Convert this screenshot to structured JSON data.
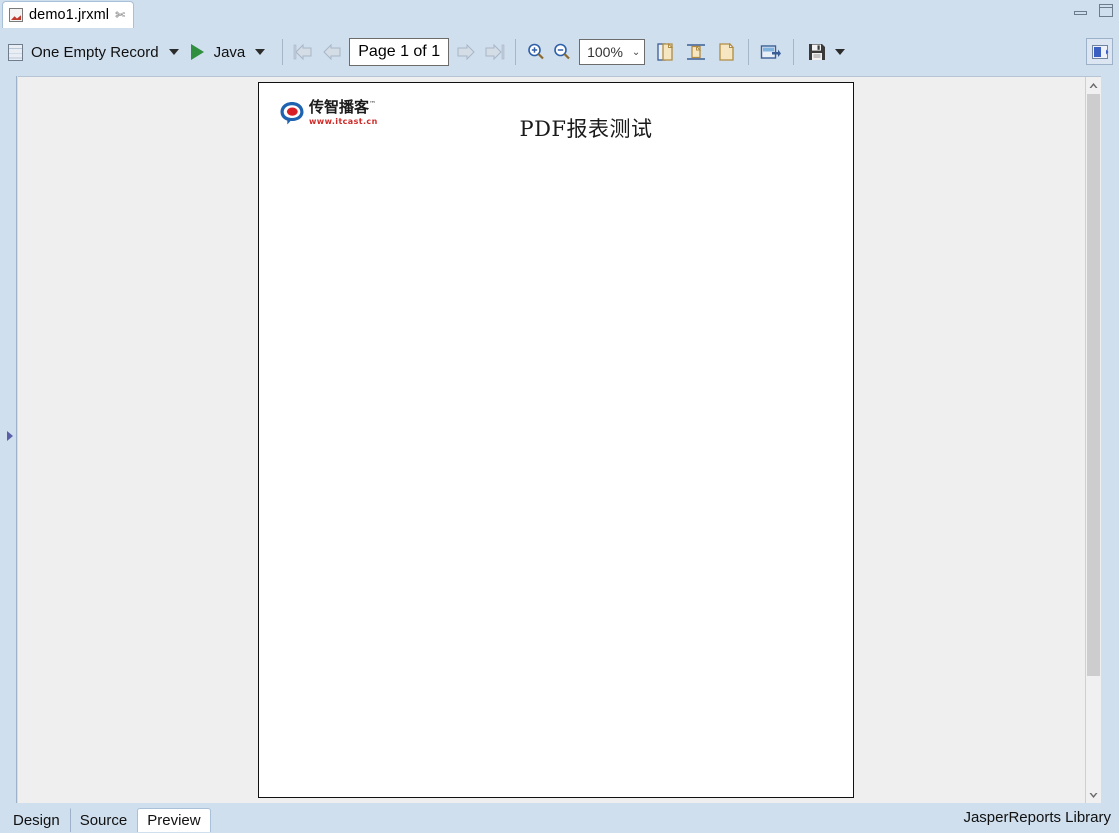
{
  "window": {
    "tab_title": "demo1.jrxml",
    "tab_close_glyph": "✄",
    "minimize_name": "minimize-button",
    "maximize_name": "maximize-button"
  },
  "toolbar": {
    "datasource_label": "One Empty Record",
    "language_label": "Java",
    "page_indicator": "Page 1 of 1",
    "zoom_value": "100%",
    "zoom_chevron": "⌄",
    "icons": {
      "datasource": "database-icon",
      "run": "run-report-icon",
      "first_page": "first-page-icon",
      "previous_page": "previous-page-icon",
      "next_page": "next-page-icon",
      "last_page": "last-page-icon",
      "zoom_in": "zoom-in-icon",
      "zoom_out": "zoom-out-icon",
      "actual_size": "actual-size-icon",
      "fit_width": "fit-width-icon",
      "fit_page": "fit-page-icon",
      "export": "export-icon",
      "save": "save-icon",
      "toggle_panel": "toggle-panel-icon"
    }
  },
  "report": {
    "logo_text": "传智播客",
    "logo_tm": "™",
    "logo_url": "www.itcast.cn",
    "title": "PDF报表测试"
  },
  "bottom": {
    "tabs": [
      {
        "label": "Design",
        "active": false
      },
      {
        "label": "Source",
        "active": false
      },
      {
        "label": "Preview",
        "active": true
      }
    ],
    "status": "JasperReports Library"
  }
}
